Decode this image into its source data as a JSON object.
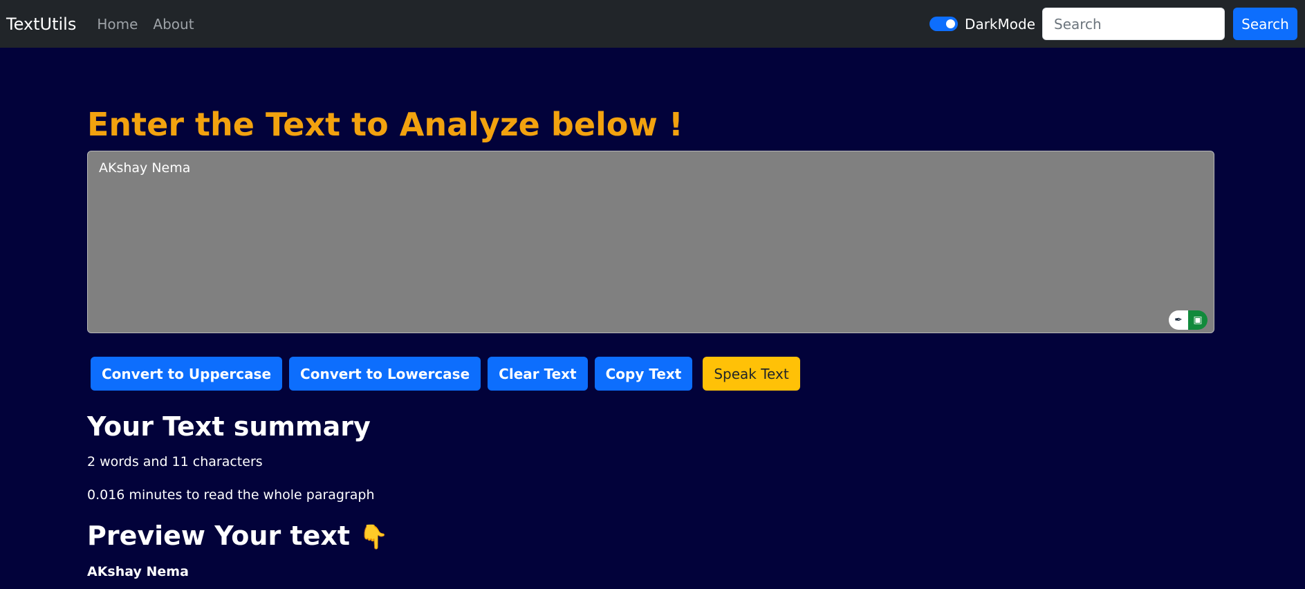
{
  "navbar": {
    "brand": "TextUtils",
    "links": [
      "Home",
      "About"
    ],
    "dark_mode_label": "DarkMode",
    "dark_mode_on": true,
    "search_placeholder": "Search",
    "search_button": "Search"
  },
  "main": {
    "heading": "Enter the Text to Analyze below !",
    "textarea_value": "AKshay Nema",
    "buttons": {
      "uppercase": "Convert to Uppercase",
      "lowercase": "Convert to Lowercase",
      "clear": "Clear Text",
      "copy": "Copy Text",
      "speak": "Speak Text"
    },
    "summary_title": "Your Text summary",
    "word_char_stat": "2 words and 11 characters",
    "read_time_stat": "0.016 minutes to read the whole paragraph",
    "preview_title": "Preview Your text",
    "preview_icon": "pointing-down-hand",
    "preview_text": "AKshay Nema"
  },
  "colors": {
    "page_bg": "#02023a",
    "navbar_bg": "#212529",
    "heading": "#f2a20f",
    "primary": "#0d6efd",
    "warning": "#ffc107",
    "textarea_bg": "#808080"
  }
}
